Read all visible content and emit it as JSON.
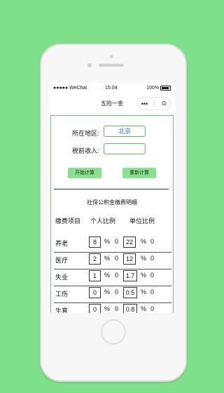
{
  "status_bar": {
    "signal": "●●●●● WeChat",
    "time": "15:04",
    "battery_percent": "100%"
  },
  "nav": {
    "title": "五险一金",
    "more_icon": "•••",
    "close_icon": "⊙"
  },
  "form": {
    "location_label": "所在地区:",
    "location_value": "北京",
    "income_label": "税前收入:",
    "income_value": "",
    "start_button": "开始计算",
    "reset_button": "重新计算"
  },
  "details": {
    "title": "社保公积金缴费明细",
    "headers": [
      "缴费项目",
      "个人比例",
      "单位比例"
    ],
    "rows": [
      {
        "name": "养老",
        "personal_rate": "8",
        "personal_unit": "%",
        "personal_amount": "0",
        "company_rate": "22",
        "company_unit": "%",
        "company_amount": "0"
      },
      {
        "name": "医疗",
        "personal_rate": "2",
        "personal_unit": "%",
        "personal_amount": "0",
        "company_rate": "12",
        "company_unit": "%",
        "company_amount": "0"
      },
      {
        "name": "失业",
        "personal_rate": "1",
        "personal_unit": "%",
        "personal_amount": "0",
        "company_rate": "1.7",
        "company_unit": "%",
        "company_amount": "0"
      },
      {
        "name": "工伤",
        "personal_rate": "0",
        "personal_unit": "%",
        "personal_amount": "0",
        "company_rate": "0.5",
        "company_unit": "%",
        "company_amount": "0"
      },
      {
        "name": "生育",
        "personal_rate": "0",
        "personal_unit": "%",
        "personal_amount": "0",
        "company_rate": "0.8",
        "company_unit": "%",
        "company_amount": "0"
      }
    ]
  },
  "colors": {
    "background": "#7fe08b",
    "accent_button": "#85e38c",
    "input_border": "#5fb863",
    "location_text": "#3b6be0"
  }
}
